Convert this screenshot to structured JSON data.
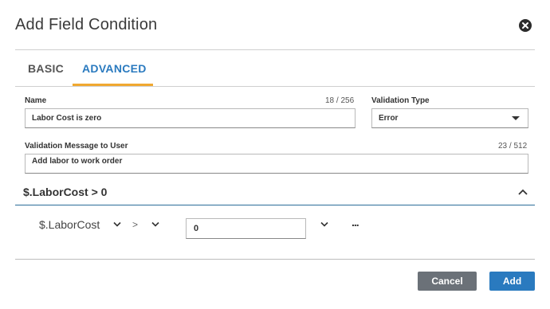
{
  "dialog": {
    "title": "Add Field Condition"
  },
  "tabs": [
    {
      "label": "BASIC",
      "active": false
    },
    {
      "label": "ADVANCED",
      "active": true
    }
  ],
  "form": {
    "name": {
      "label": "Name",
      "value": "Labor Cost is zero",
      "counter": "18 / 256"
    },
    "validation_type": {
      "label": "Validation Type",
      "value": "Error"
    },
    "message": {
      "label": "Validation Message to User",
      "value": "Add labor to work order",
      "counter": "23 / 512"
    }
  },
  "condition": {
    "header": "$.LaborCost > 0",
    "field": "$.LaborCost",
    "operator": ">",
    "value": "0",
    "more": "..."
  },
  "footer": {
    "cancel_label": "Cancel",
    "add_label": "Add"
  },
  "colors": {
    "accent": "#2a7abf",
    "tab_underline": "#f0a830",
    "cancel_bg": "#6b7178"
  }
}
